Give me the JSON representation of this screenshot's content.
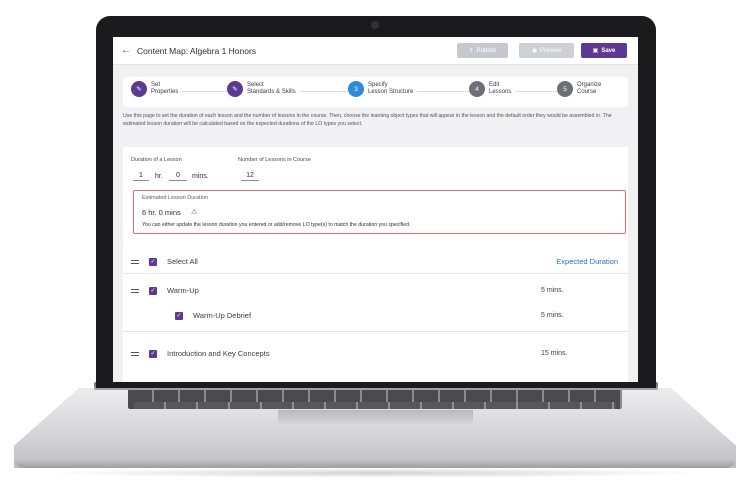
{
  "header": {
    "back_icon": "arrow-left-icon",
    "title": "Content Map: Algebra 1 Honors",
    "publish_label": "Publish",
    "preview_label": "Preview",
    "save_label": "Save"
  },
  "steps": [
    {
      "label": "Set\nProperties",
      "status": "done",
      "icon": "pencil-icon"
    },
    {
      "label": "Select\nStandards & Skills",
      "status": "done",
      "icon": "pencil-icon"
    },
    {
      "number": "3",
      "label": "Specify\nLesson Structure",
      "status": "current"
    },
    {
      "number": "4",
      "label": "Edit\nLessons",
      "status": "todo"
    },
    {
      "number": "5",
      "label": "Organize\nCourse",
      "status": "todo"
    }
  ],
  "intro_text": "Use this page to set the duration of each lesson and the number of lessons in the course. Then, choose the learning object types that will appear in the lesson and the default order they would be assembled in. The estimated lesson duration will be calculated based on the expected durations of the LO types you select.",
  "duration": {
    "label": "Duration of a Lesson",
    "hours": "1",
    "hours_unit": "hr.",
    "minutes": "0",
    "minutes_unit": "mins."
  },
  "lessons_count": {
    "label": "Number of Lessons in Course",
    "value": "12"
  },
  "estimate": {
    "label": "Estimated Lesson Duration",
    "value": "6 hr. 0 mins",
    "warning_icon": "warning-icon",
    "message": "You can either update the lesson duration you entered or add/remove LO type(s) to match the duration you specified."
  },
  "list": {
    "select_all_label": "Select All",
    "expected_duration_header": "Expected Duration",
    "items": [
      {
        "label": "Warm-Up",
        "duration": "5 mins."
      },
      {
        "label": "Warm-Up Debrief",
        "duration": "5 mins."
      },
      {
        "label": "Introduction and Key Concepts",
        "duration": "15 mins."
      }
    ]
  },
  "colors": {
    "primary": "#5c3a92",
    "current_step": "#2f8ad8",
    "warning_border": "#e06b6b",
    "link": "#2f6fb8"
  }
}
